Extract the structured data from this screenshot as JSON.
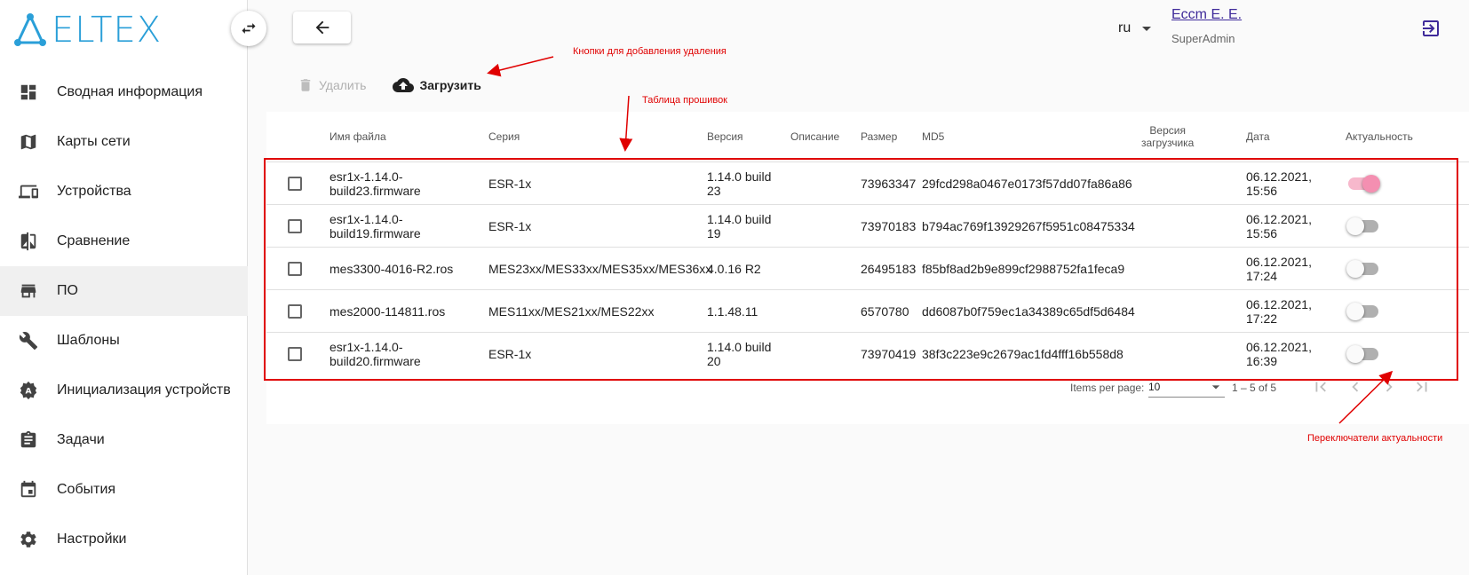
{
  "brand": {
    "logo_text": "ELTEX"
  },
  "sidebar": {
    "items": [
      {
        "label": "Сводная информация",
        "icon": "dashboard-icon"
      },
      {
        "label": "Карты сети",
        "icon": "map-icon"
      },
      {
        "label": "Устройства",
        "icon": "devices-icon"
      },
      {
        "label": "Сравнение",
        "icon": "compare-icon"
      },
      {
        "label": "ПО",
        "icon": "store-icon",
        "active": true
      },
      {
        "label": "Шаблоны",
        "icon": "wrench-icon"
      },
      {
        "label": "Инициализация устройств",
        "icon": "auto-init-icon"
      },
      {
        "label": "Задачи",
        "icon": "clipboard-icon"
      },
      {
        "label": "События",
        "icon": "calendar-icon"
      },
      {
        "label": "Настройки",
        "icon": "gear-icon"
      }
    ]
  },
  "header": {
    "language": "ru",
    "user_name": "Eccm E. E.",
    "user_role": "SuperAdmin"
  },
  "toolbar": {
    "delete_label": "Удалить",
    "upload_label": "Загрузить"
  },
  "table": {
    "columns": {
      "filename": "Имя файла",
      "series": "Серия",
      "version": "Версия",
      "description": "Описание",
      "size": "Размер",
      "md5": "MD5",
      "bootloader_line1": "Версия",
      "bootloader_line2": "загрузчика",
      "date": "Дата",
      "actual": "Актуальность"
    },
    "rows": [
      {
        "filename_1": "esr1x-1.14.0-",
        "filename_2": "build23.firmware",
        "series": "ESR-1x",
        "version_1": "1.14.0 build",
        "version_2": "23",
        "description": "",
        "size": "73963347",
        "md5": "29fcd298a0467e0173f57dd07fa86a86",
        "bootloader": "",
        "date_1": "06.12.2021,",
        "date_2": "15:56",
        "actual": true
      },
      {
        "filename_1": "esr1x-1.14.0-",
        "filename_2": "build19.firmware",
        "series": "ESR-1x",
        "version_1": "1.14.0 build",
        "version_2": "19",
        "description": "",
        "size": "73970183",
        "md5": "b794ac769f13929267f5951c08475334",
        "bootloader": "",
        "date_1": "06.12.2021,",
        "date_2": "15:56",
        "actual": false
      },
      {
        "filename_1": "mes3300-4016-R2.ros",
        "filename_2": "",
        "series": "MES23xx/MES33xx/MES35xx/MES36xx",
        "version_1": "4.0.16 R2",
        "version_2": "",
        "description": "",
        "size": "26495183",
        "md5": "f85bf8ad2b9e899cf2988752fa1feca9",
        "bootloader": "",
        "date_1": "06.12.2021,",
        "date_2": "17:24",
        "actual": false
      },
      {
        "filename_1": "mes2000-114811.ros",
        "filename_2": "",
        "series": "MES11xx/MES21xx/MES22xx",
        "version_1": "1.1.48.11",
        "version_2": "",
        "description": "",
        "size": "6570780",
        "md5": "dd6087b0f759ec1a34389c65df5d6484",
        "bootloader": "",
        "date_1": "06.12.2021,",
        "date_2": "17:22",
        "actual": false
      },
      {
        "filename_1": "esr1x-1.14.0-",
        "filename_2": "build20.firmware",
        "series": "ESR-1x",
        "version_1": "1.14.0 build",
        "version_2": "20",
        "description": "",
        "size": "73970419",
        "md5": "38f3c223e9c2679ac1fd4fff16b558d8",
        "bootloader": "",
        "date_1": "06.12.2021,",
        "date_2": "16:39",
        "actual": false
      }
    ]
  },
  "paginator": {
    "items_per_page_label": "Items per page:",
    "items_per_page_value": "10",
    "range_label": "1 – 5 of 5"
  },
  "annotations": {
    "buttons_note": "Кнопки для добавления удаления",
    "table_note": "Таблица прошивок",
    "toggles_note": "Переключатели актуальности"
  },
  "colors": {
    "brand": "#2a9fd8",
    "annotation": "#e00000",
    "toggle_on": "#f48fb1",
    "user_link": "#3f2a9a"
  }
}
